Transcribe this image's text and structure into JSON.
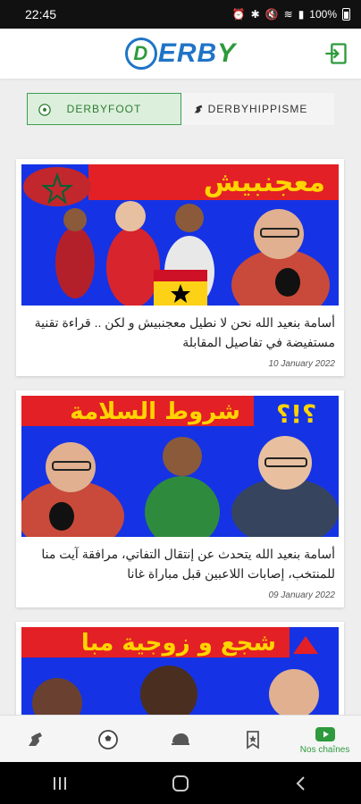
{
  "status": {
    "time": "22:45",
    "battery": "100%"
  },
  "header": {
    "logo_letters": "DERBY",
    "logo_d": "D",
    "logo_mid": "ERB",
    "logo_end": "Y"
  },
  "tabs": [
    {
      "label": "DERBYFOOT",
      "icon": "soccer-ball-icon",
      "active": true
    },
    {
      "label": "DERBYHIPPISME",
      "icon": "horse-icon",
      "active": false
    }
  ],
  "articles": [
    {
      "title": "أسامة بنعيد الله نحن لا نطيل معجنبيش و لكن .. قراءة تقنية مستفيضة في تفاصيل المقابلة",
      "date": "10 January 2022",
      "banner_text": "معجنبيش"
    },
    {
      "title": "أسامة بنعيد الله يتحدث عن إنتقال التفاتي، مرافقة آيت منا للمنتخب، إصابات اللاعبين قبل مباراة غانا",
      "date": "09 January 2022",
      "banner_text": "شروط السلامة"
    },
    {
      "title": "",
      "date": "",
      "banner_text": "شجع و زوجية مبا"
    }
  ],
  "bottom_nav": [
    {
      "icon": "horse-icon",
      "label": ""
    },
    {
      "icon": "soccer-ball-icon",
      "label": ""
    },
    {
      "icon": "helmet-icon",
      "label": ""
    },
    {
      "icon": "bookmark-star-icon",
      "label": ""
    },
    {
      "icon": "youtube-icon",
      "label": "Nos chaînes"
    }
  ],
  "colors": {
    "green": "#2e9a3d",
    "blue": "#1f74c6",
    "banner_red": "#e32025",
    "banner_blue": "#1533e4",
    "banner_yellow": "#ffd400"
  }
}
